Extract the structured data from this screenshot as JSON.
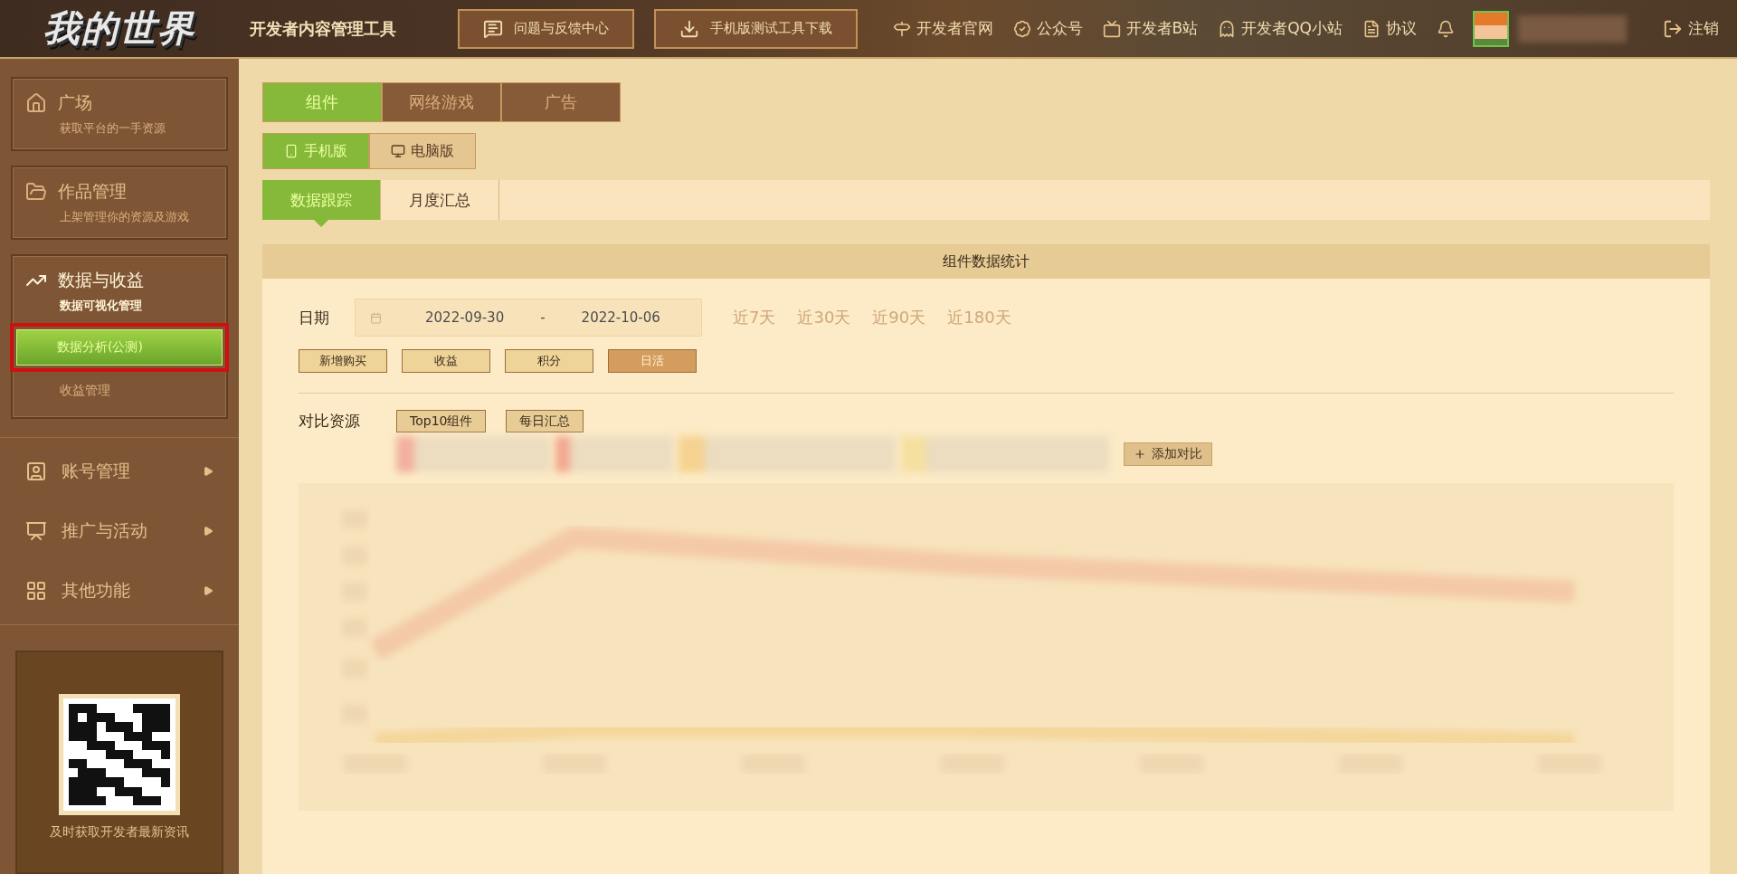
{
  "header": {
    "logo": "我的世界",
    "title": "开发者内容管理工具",
    "buttons": [
      {
        "label": "问题与反馈中心",
        "kind": "feedback"
      },
      {
        "label": "手机版测试工具下载",
        "kind": "download"
      }
    ],
    "links": [
      {
        "label": "开发者官网",
        "kind": "site"
      },
      {
        "label": "公众号",
        "kind": "wechat"
      },
      {
        "label": "开发者B站",
        "kind": "video"
      },
      {
        "label": "开发者QQ小站",
        "kind": "qq"
      },
      {
        "label": "协议",
        "kind": "doc"
      }
    ],
    "logout": "注销"
  },
  "sidebar": {
    "cards": [
      {
        "title": "广场",
        "subtitle": "获取平台的一手资源",
        "kind": "home",
        "expanded": false
      },
      {
        "title": "作品管理",
        "subtitle": "上架管理你的资源及游戏",
        "kind": "folder",
        "expanded": false
      },
      {
        "title": "数据与收益",
        "subtitle": "数据可视化管理",
        "kind": "chart",
        "expanded": true,
        "items": [
          {
            "label": "数据分析(公测)",
            "selected": true,
            "highlighted": true
          },
          {
            "label": "收益管理",
            "selected": false,
            "highlighted": false
          }
        ]
      }
    ],
    "menu": [
      {
        "label": "账号管理",
        "kind": "account"
      },
      {
        "label": "推广与活动",
        "kind": "sign"
      },
      {
        "label": "其他功能",
        "kind": "grid"
      }
    ],
    "qr_caption": "及时获取开发者最新资讯"
  },
  "main": {
    "category_tabs": [
      {
        "label": "组件",
        "selected": true
      },
      {
        "label": "网络游戏",
        "selected": false
      },
      {
        "label": "广告",
        "selected": false
      }
    ],
    "platform_tabs": [
      {
        "label": "手机版",
        "kind": "phone",
        "selected": true
      },
      {
        "label": "电脑版",
        "kind": "pc",
        "selected": false
      }
    ],
    "view_tabs": [
      {
        "label": "数据跟踪",
        "selected": true
      },
      {
        "label": "月度汇总",
        "selected": false
      }
    ],
    "panel": {
      "title": "组件数据统计",
      "date_label": "日期",
      "start_date": "2022-09-30",
      "separator": "-",
      "end_date": "2022-10-06",
      "quick_ranges": [
        "近7天",
        "近30天",
        "近90天",
        "近180天"
      ],
      "metrics": [
        {
          "label": "新增购买",
          "selected": false
        },
        {
          "label": "收益",
          "selected": false
        },
        {
          "label": "积分",
          "selected": false
        },
        {
          "label": "日活",
          "selected": true
        }
      ],
      "compare_label": "对比资源",
      "compare_buttons": [
        "Top10组件",
        "每日汇总"
      ],
      "add_compare": "添加对比"
    }
  }
}
